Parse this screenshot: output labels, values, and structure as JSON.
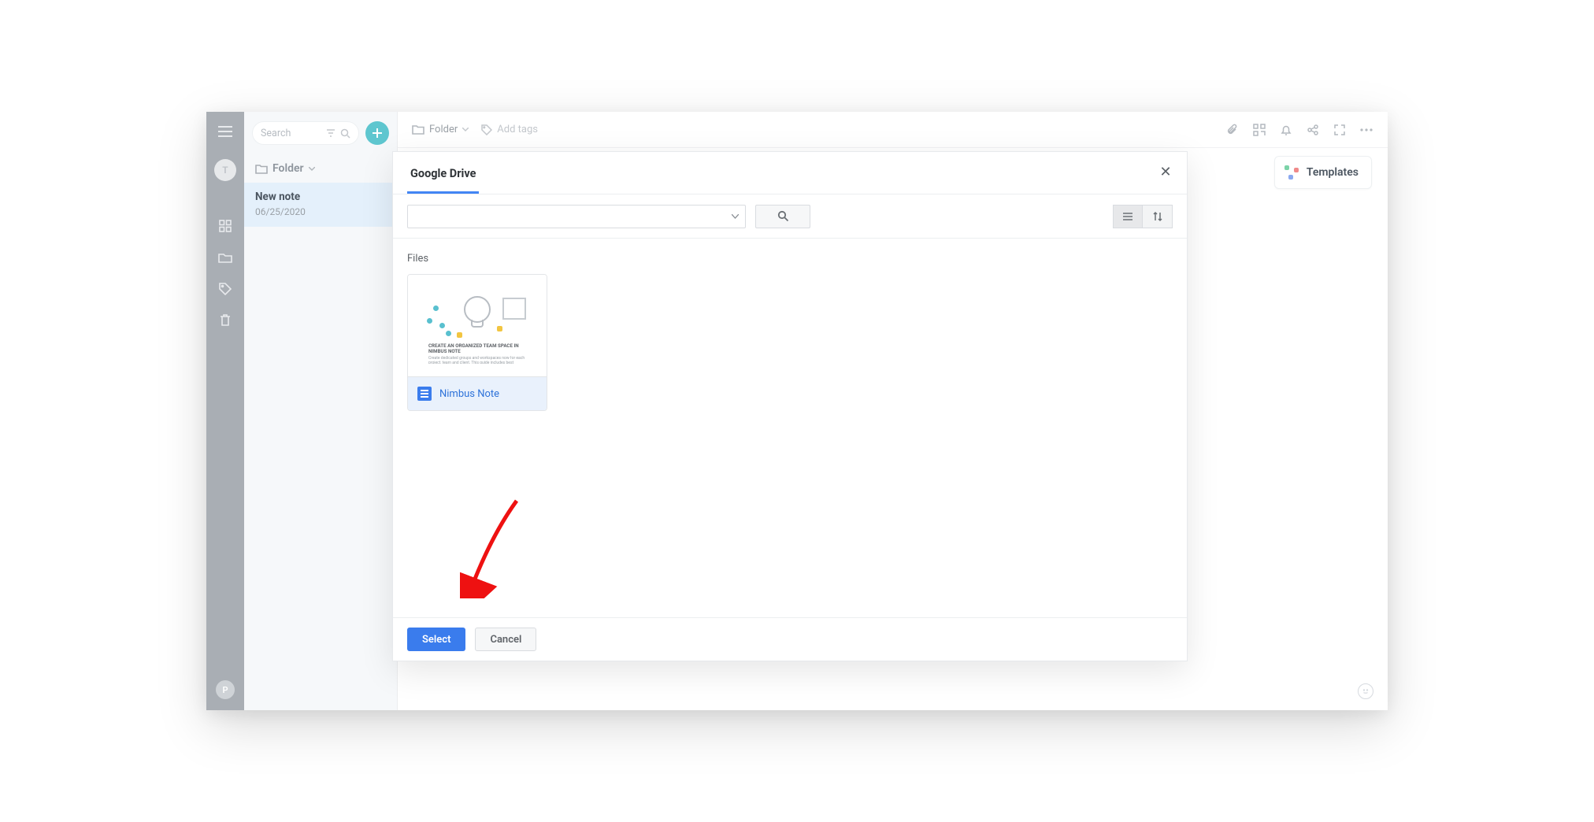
{
  "search": {
    "placeholder": "Search"
  },
  "sidebar": {
    "top_avatar_initial": "T",
    "bottom_avatar_initial": "P"
  },
  "list": {
    "folder_label": "Folder",
    "note": {
      "title": "New note",
      "date": "06/25/2020"
    }
  },
  "editor_top": {
    "folder_crumb": "Folder",
    "add_tags": "Add tags"
  },
  "templates_chip": "Templates",
  "modal": {
    "title": "Google Drive",
    "section": "Files",
    "file": {
      "name": "Nimbus Note",
      "thumb_caption": "CREATE AN ORGANIZED TEAM SPACE IN NIMBUS NOTE",
      "thumb_sub": "Create dedicated groups and workspaces now for each project, team and client. This guide includes best practices and some examples which can help you create a tidy..."
    },
    "buttons": {
      "select": "Select",
      "cancel": "Cancel"
    }
  }
}
